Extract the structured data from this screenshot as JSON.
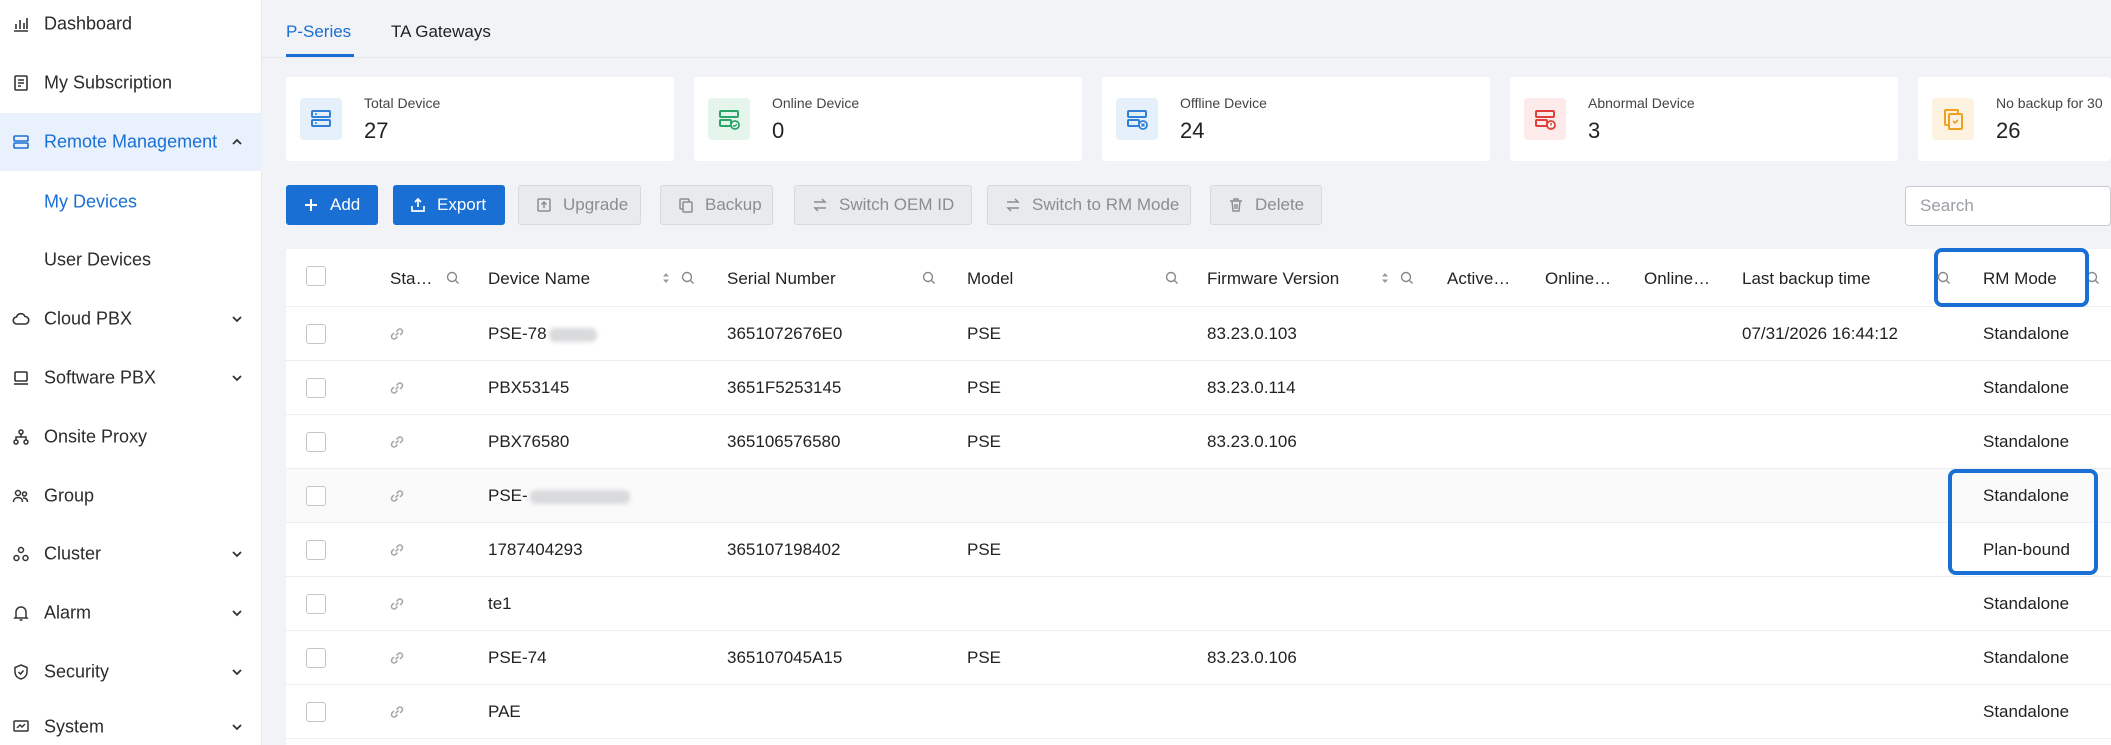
{
  "sidebar": {
    "items": [
      {
        "label": "Dashboard",
        "icon": "chart-icon"
      },
      {
        "label": "My Subscription",
        "icon": "receipt-icon"
      },
      {
        "label": "Remote Management",
        "icon": "server-icon",
        "expanded": true
      },
      {
        "label": "My Devices"
      },
      {
        "label": "User Devices"
      },
      {
        "label": "Cloud PBX",
        "icon": "cloud-icon"
      },
      {
        "label": "Software PBX",
        "icon": "software-icon"
      },
      {
        "label": "Onsite Proxy",
        "icon": "proxy-icon"
      },
      {
        "label": "Group",
        "icon": "group-icon"
      },
      {
        "label": "Cluster",
        "icon": "cluster-icon"
      },
      {
        "label": "Alarm",
        "icon": "bell-icon"
      },
      {
        "label": "Security",
        "icon": "shield-icon"
      },
      {
        "label": "System",
        "icon": "system-icon"
      }
    ]
  },
  "tabs": [
    {
      "label": "P-Series",
      "active": true
    },
    {
      "label": "TA Gateways",
      "active": false
    }
  ],
  "stats": [
    {
      "label": "Total Device",
      "value": "27",
      "color": "#2f80d8",
      "bg": "#e6f0fb"
    },
    {
      "label": "Online Device",
      "value": "0",
      "color": "#2aa66a",
      "bg": "#e5f5ec"
    },
    {
      "label": "Offline Device",
      "value": "24",
      "color": "#2f80d8",
      "bg": "#e6f0fb"
    },
    {
      "label": "Abnormal Device",
      "value": "3",
      "color": "#e0403a",
      "bg": "#fdeaea"
    },
    {
      "label": "No backup for 30",
      "value": "26",
      "color": "#f0a020",
      "bg": "#fdf2df"
    }
  ],
  "toolbar": {
    "add": "Add",
    "export": "Export",
    "upgrade": "Upgrade",
    "backup": "Backup",
    "switch_oem": "Switch OEM ID",
    "switch_rm": "Switch to RM Mode",
    "delete": "Delete",
    "search_placeholder": "Search"
  },
  "table": {
    "columns": {
      "status": "Sta…",
      "device_name": "Device Name",
      "serial": "Serial Number",
      "model": "Model",
      "firmware": "Firmware Version",
      "active": "Active…",
      "online1": "Online…",
      "online2": "Online…",
      "last_backup": "Last backup time",
      "rm_mode": "RM Mode"
    },
    "rows": [
      {
        "name": "PSE-78",
        "serial": "3651072676E0",
        "model": "PSE",
        "firmware": "83.23.0.103",
        "backup": "07/31/2026 16:44:12",
        "rm": "Standalone"
      },
      {
        "name": "PBX53145",
        "serial": "3651F5253145",
        "model": "PSE",
        "firmware": "83.23.0.114",
        "backup": "",
        "rm": "Standalone"
      },
      {
        "name": "PBX76580",
        "serial": "365106576580",
        "model": "PSE",
        "firmware": "83.23.0.106",
        "backup": "",
        "rm": "Standalone"
      },
      {
        "name": "PSE-",
        "serial": "",
        "model": "",
        "firmware": "",
        "backup": "",
        "rm": "Standalone"
      },
      {
        "name": "1787404293",
        "serial": "365107198402",
        "model": "PSE",
        "firmware": "",
        "backup": "",
        "rm": "Plan-bound"
      },
      {
        "name": "te1",
        "serial": "",
        "model": "",
        "firmware": "",
        "backup": "",
        "rm": "Standalone"
      },
      {
        "name": "PSE-74",
        "serial": "365107045A15",
        "model": "PSE",
        "firmware": "83.23.0.106",
        "backup": "",
        "rm": "Standalone"
      },
      {
        "name": "PAE",
        "serial": "",
        "model": "",
        "firmware": "",
        "backup": "",
        "rm": "Standalone"
      }
    ]
  },
  "colors": {
    "accent": "#1a6fd4",
    "highlight": "#1a6fd4"
  }
}
